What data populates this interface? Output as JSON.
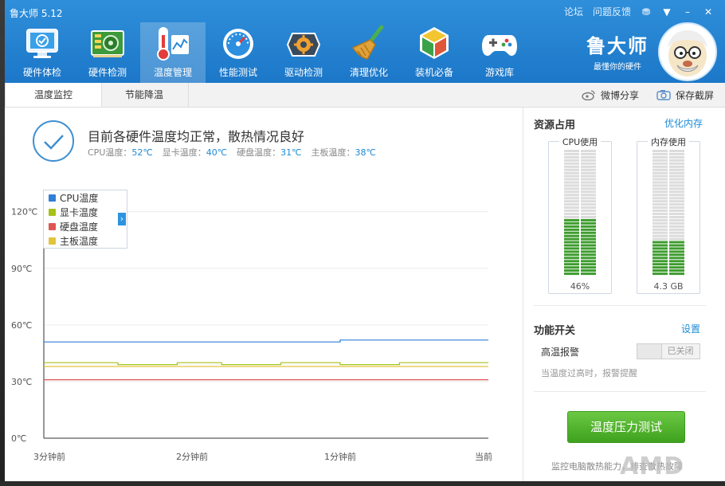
{
  "window": {
    "title": "鲁大师 5.12",
    "links": [
      "论坛",
      "问题反馈"
    ],
    "controls": {
      "skin": "⛃",
      "menu": "▼",
      "minimize": "–",
      "close": "✕"
    }
  },
  "nav": {
    "items": [
      {
        "label": "硬件体检",
        "icon": "monitor-check-icon",
        "active": false
      },
      {
        "label": "硬件检测",
        "icon": "circuit-board-icon",
        "active": false
      },
      {
        "label": "温度管理",
        "icon": "thermometer-icon",
        "active": true
      },
      {
        "label": "性能测试",
        "icon": "speedometer-icon",
        "active": false
      },
      {
        "label": "驱动检测",
        "icon": "driver-gear-icon",
        "active": false
      },
      {
        "label": "清理优化",
        "icon": "broom-icon",
        "active": false
      },
      {
        "label": "装机必备",
        "icon": "cube-box-icon",
        "active": false
      },
      {
        "label": "游戏库",
        "icon": "gamepad-icon",
        "active": false
      }
    ]
  },
  "brand": {
    "name": "鲁大师",
    "slogan": "最懂你的硬件"
  },
  "subtabs": [
    {
      "label": "温度监控",
      "active": true
    },
    {
      "label": "节能降温",
      "active": false
    }
  ],
  "sub_actions": {
    "share": "微博分享",
    "screenshot": "保存截屏"
  },
  "status": {
    "title": "目前各硬件温度均正常，散热情况良好",
    "readings": [
      {
        "label": "CPU温度：",
        "value": "52℃"
      },
      {
        "label": "显卡温度：",
        "value": "40℃"
      },
      {
        "label": "硬盘温度：",
        "value": "31℃"
      },
      {
        "label": "主板温度：",
        "value": "38℃"
      }
    ]
  },
  "colors": {
    "accent": "#1d8bd6",
    "cpu": "#2f7fd8",
    "gpu": "#a5c21a",
    "disk": "#e05454",
    "board": "#e2c43a",
    "meter_on": "#3e9c2e",
    "meter_off": "#dcdcdc"
  },
  "chart_data": {
    "type": "line",
    "x": [
      0,
      1,
      2,
      3
    ],
    "x_tick_labels": [
      "3分钟前",
      "2分钟前",
      "1分钟前",
      "当前"
    ],
    "y_ticks": [
      0,
      30,
      60,
      90,
      120
    ],
    "y_tick_labels": [
      "0℃",
      "30℃",
      "60℃",
      "90℃",
      "120℃"
    ],
    "ylim": [
      0,
      130
    ],
    "grid": true,
    "legend_position": "top-left",
    "series": [
      {
        "name": "CPU温度",
        "color": "#2f7fd8",
        "x": [
          0,
          2,
          2,
          3
        ],
        "values": [
          51,
          51,
          52,
          52
        ]
      },
      {
        "name": "显卡温度",
        "color": "#a5c21a",
        "x": [
          0,
          0.5,
          0.5,
          0.9,
          0.9,
          1.2,
          1.2,
          1.6,
          1.6,
          2.0,
          2.0,
          2.4,
          2.4,
          3
        ],
        "values": [
          40,
          40,
          39,
          39,
          40,
          40,
          39,
          39,
          40,
          40,
          39,
          39,
          40,
          40
        ]
      },
      {
        "name": "硬盘温度",
        "color": "#e05454",
        "x": [
          0,
          3
        ],
        "values": [
          31,
          31
        ]
      },
      {
        "name": "主板温度",
        "color": "#e2c43a",
        "x": [
          0,
          3
        ],
        "values": [
          38,
          38
        ]
      }
    ]
  },
  "chart": {
    "legend_toggle": "›"
  },
  "resources": {
    "title": "资源占用",
    "optimize": "优化内存",
    "cpu": {
      "label": "CPU使用",
      "value": "46%",
      "fraction": 0.46
    },
    "memory": {
      "label": "内存使用",
      "value": "4.3 GB",
      "fraction": 0.27
    }
  },
  "features": {
    "title": "功能开关",
    "settings": "设置",
    "alarm_label": "高温报警",
    "alarm_state": "已关闭",
    "hint": "当温度过高时，报警提醒"
  },
  "stress_button": "温度压力测试",
  "footer_text": "监控电脑散热能力，排查散热故障",
  "watermark": "AMD"
}
